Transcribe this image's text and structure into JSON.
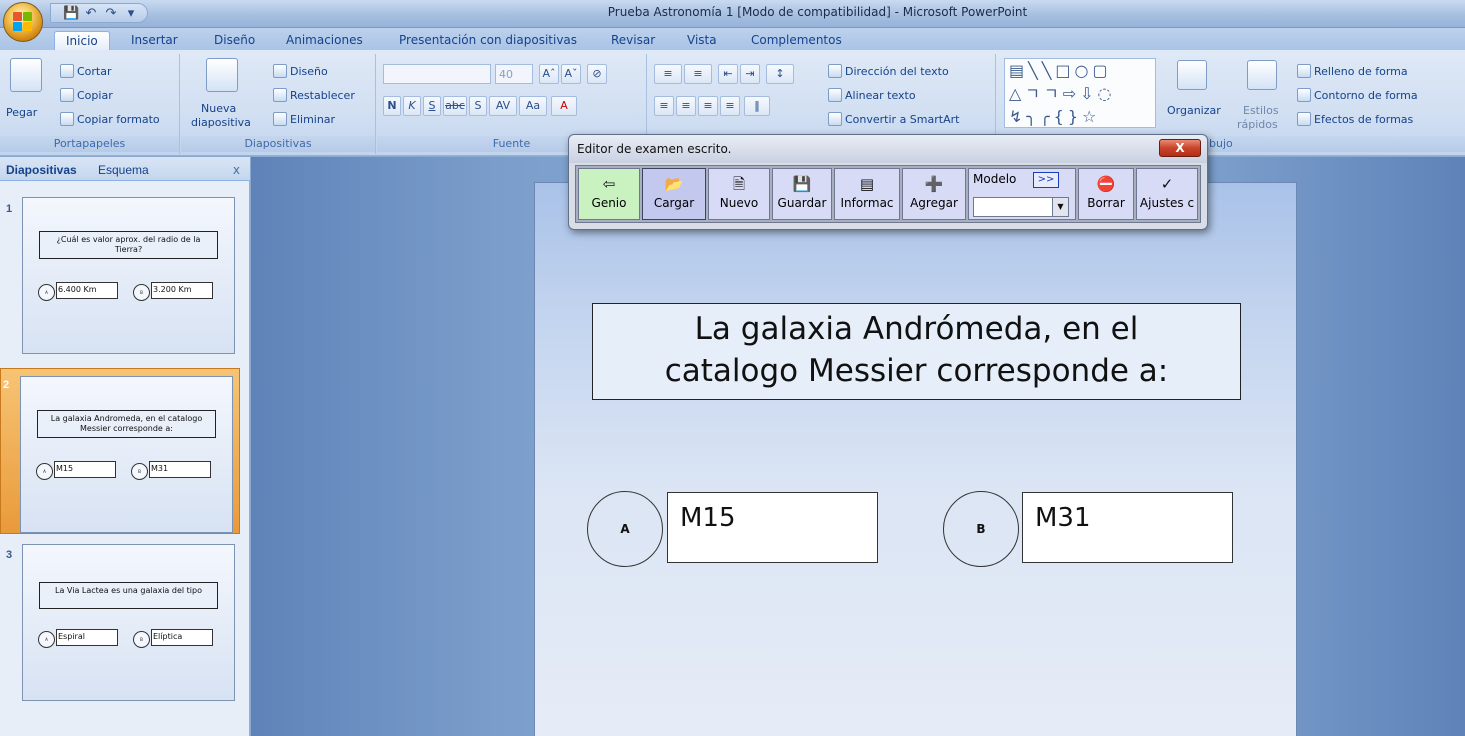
{
  "window": {
    "title": "Prueba Astronomía 1 [Modo de compatibilidad] - Microsoft PowerPoint"
  },
  "quick_access": {
    "save_icon": "save-icon",
    "undo_icon": "undo-icon",
    "redo_icon": "redo-icon"
  },
  "tabs": [
    "Inicio",
    "Insertar",
    "Diseño",
    "Animaciones",
    "Presentación con diapositivas",
    "Revisar",
    "Vista",
    "Complementos"
  ],
  "ribbon": {
    "portapapeles": {
      "label": "Portapapeles",
      "pegar": "Pegar",
      "cortar": "Cortar",
      "copiar": "Copiar",
      "copiar_formato": "Copiar formato"
    },
    "diapositivas": {
      "label": "Diapositivas",
      "nueva": "Nueva",
      "nueva2": "diapositiva",
      "diseno": "Diseño",
      "restablecer": "Restablecer",
      "eliminar": "Eliminar"
    },
    "fuente": {
      "label": "Fuente",
      "font_size": "40",
      "bold": "N",
      "italic": "K",
      "underline": "S",
      "strike": "abc",
      "shadow": "S",
      "spacing": "AV",
      "case": "Aa",
      "color": "A"
    },
    "parrafo": {
      "direccion": "Dirección del texto",
      "alinear": "Alinear texto",
      "smartart": "Convertir a SmartArt"
    },
    "dibujo": {
      "label": "Dibujo",
      "label_visible": "bujo",
      "organizar": "Organizar",
      "estilos": "Estilos",
      "estilos2": "rápidos",
      "relleno": "Relleno de forma",
      "contorno": "Contorno de forma",
      "efectos": "Efectos de formas"
    }
  },
  "panel": {
    "tab_diapositivas": "Diapositivas",
    "tab_esquema": "Esquema",
    "close": "x",
    "slides": [
      {
        "number": "1",
        "question": "¿Cuál es valor aprox. del radio de la Tierra?",
        "option_a": "6.400 Km",
        "option_b": "3.200 Km",
        "circle_a": "A",
        "circle_b": "B"
      },
      {
        "number": "2",
        "question": "La galaxia Andromeda, en el catalogo Messier corresponde a:",
        "option_a": "M15",
        "option_b": "M31",
        "circle_a": "A",
        "circle_b": "B"
      },
      {
        "number": "3",
        "question": "La Via Lactea es una galaxia del tipo",
        "option_a": "Espiral",
        "option_b": "Elíptica",
        "circle_a": "A",
        "circle_b": "B"
      }
    ]
  },
  "slide": {
    "question_line1": "La galaxia Andrómeda, en el",
    "question_line2": "catalogo Messier corresponde a:",
    "circle_a": "A",
    "circle_b": "B",
    "option_a": "M15",
    "option_b": "M31"
  },
  "editor": {
    "title": "Editor de examen escrito.",
    "close": "X",
    "buttons": [
      {
        "label": "Genio",
        "icon": "arrow-left-icon"
      },
      {
        "label": "Cargar",
        "icon": "folder-open-icon"
      },
      {
        "label": "Nuevo",
        "icon": "new-file-icon"
      },
      {
        "label": "Guardar",
        "icon": "save-icon"
      },
      {
        "label": "Informac",
        "icon": "info-icon"
      },
      {
        "label": "Agregar",
        "icon": "plus-icon"
      },
      {
        "label": "Borrar",
        "icon": "delete-icon"
      },
      {
        "label": "Ajustes c",
        "icon": "spellcheck-icon"
      }
    ],
    "modelo_label": "Modelo",
    "modelo_next": ">>",
    "modelo_value": ""
  },
  "colors": {
    "accent": "#15428b",
    "selected_slide": "#e99a3a",
    "close_red": "#c9442b",
    "green_button": "#c9f2c0"
  }
}
